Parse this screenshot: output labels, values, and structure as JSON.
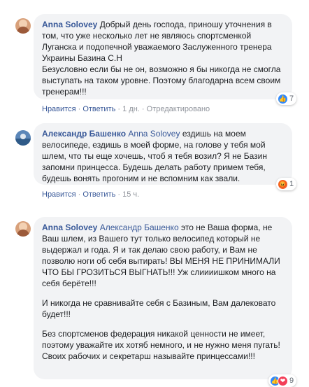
{
  "comments": [
    {
      "author": "Anna Solovey",
      "mention": "",
      "paragraphs": [
        "Добрый день господа, приношу уточнения в том, что уже несколько лет не являюсь спортсменкой Луганска и подопечной уважаемого Заслуженного тренера Украины Базина С.Н",
        "Безусловно если бы не он, возможно я бы никогда не смогла выступать на таком уровне. Поэтому благодарна всем своим тренерам!!!"
      ],
      "reaction_icons": [
        "like-icon"
      ],
      "reaction_count": "7",
      "like_label": "Нравится",
      "reply_label": "Ответить",
      "time": "1 дн.",
      "edited": "Отредактировано"
    },
    {
      "author": "Александр Башенко",
      "mention": "Anna Solovey",
      "paragraphs": [
        "ездишь на моем велосипеде, ездишь в моей форме, на голове у тебя мой шлем, что ты еще хочешь, чтоб я тебя возил? Я не Базин запомни принцесса. Будешь делать работу примем тебя, будешь вонять прогоним и не вспомним как звали."
      ],
      "reaction_icons": [
        "angry-icon"
      ],
      "reaction_count": "1",
      "like_label": "Нравится",
      "reply_label": "Ответить",
      "time": "15 ч."
    },
    {
      "author": "Anna Solovey",
      "mention": "Александр Башенко",
      "paragraphs": [
        "это не Ваша форма, не Ваш шлем, из Вашего тут только велосипед который не выдержал и года. Я и так делаю свою работу, и Вам не позволю ноги об себя вытирать! ВЫ МЕНЯ НЕ ПРИНИМАЛИ ЧТО БЫ ГРОЗИТЬСЯ ВЫГНАТЬ!!! Уж слиииишком много на себя берёте!!!",
        "И никогда не сравнивайте себя с Базиным, Вам далековато будет!!!",
        "Без спортсменов федерация никакой ценности не имеет, поэтому уважайте их хотяб немного, и не нужно меня пугать! Своих рабочих и секретарш называйте принцессами!!!"
      ],
      "reaction_icons": [
        "like-icon",
        "love-icon"
      ],
      "reaction_count": "9"
    }
  ],
  "colors": {
    "link": "#385898",
    "bubble": "#f2f3f5",
    "meta": "#90949c",
    "like": "#2e89ff",
    "angry": "#f0622a",
    "love": "#f33e58"
  }
}
